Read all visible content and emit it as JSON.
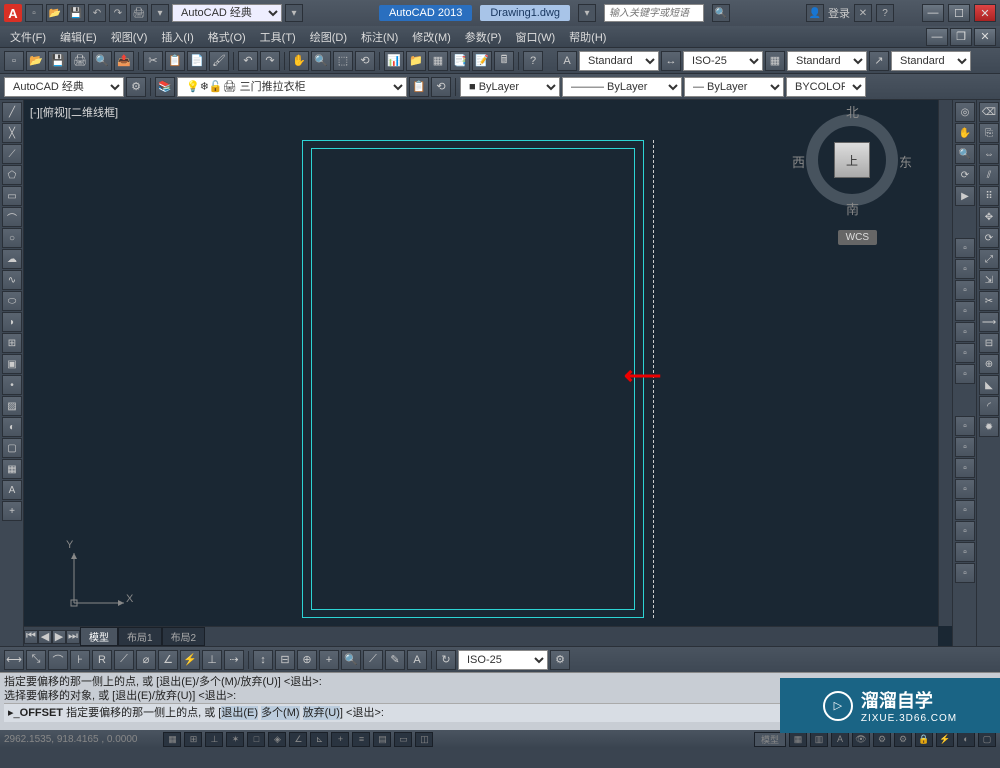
{
  "title": {
    "workspace_dropdown": "AutoCAD 经典",
    "app_name": "AutoCAD 2013",
    "document": "Drawing1.dwg",
    "search_placeholder": "输入关键字或短语",
    "login": "登录"
  },
  "menu": {
    "file": "文件(F)",
    "edit": "编辑(E)",
    "view": "视图(V)",
    "insert": "插入(I)",
    "format": "格式(O)",
    "tools": "工具(T)",
    "draw": "绘图(D)",
    "dimension": "标注(N)",
    "modify": "修改(M)",
    "parametric": "参数(P)",
    "window": "窗口(W)",
    "help": "帮助(H)"
  },
  "toolbar1": {
    "textstyle": "Standard",
    "dimstyle": "ISO-25",
    "tablestyle": "Standard",
    "mleaderstyle": "Standard"
  },
  "toolbar2": {
    "workspace": "AutoCAD 经典",
    "layer_name": "三门推拉衣柜",
    "layer_color": "ByLayer",
    "linetype": "ByLayer",
    "lineweight": "ByLayer",
    "plotcolor": "BYCOLOR"
  },
  "viewport": {
    "label": "[-][俯视][二维线框]",
    "cube_top": "上",
    "compass_n": "北",
    "compass_s": "南",
    "compass_e": "东",
    "compass_w": "西",
    "wcs": "WCS",
    "axis_x": "X",
    "axis_y": "Y"
  },
  "tabs": {
    "model": "模型",
    "layout1": "布局1",
    "layout2": "布局2"
  },
  "dim_toolbar": {
    "style": "ISO-25"
  },
  "command": {
    "line1": "指定要偏移的那一侧上的点, 或 [退出(E)/多个(M)/放弃(U)] <退出>:",
    "line2": "选择要偏移的对象, 或 [退出(E)/放弃(U)] <退出>:",
    "prompt_cmd": "OFFSET",
    "prompt_text": "指定要偏移的那一侧上的点, 或 [",
    "prompt_exit": "退出(E)",
    "prompt_multi": "多个(M)",
    "prompt_undo": "放弃(U)",
    "prompt_tail": "] <退出>:"
  },
  "statusbar": {
    "coords": "2962.1535, 918.4165 , 0.0000",
    "mode_model": "模型"
  },
  "watermark": {
    "text": "溜溜自学",
    "sub": "ZIXUE.3D66.COM"
  }
}
